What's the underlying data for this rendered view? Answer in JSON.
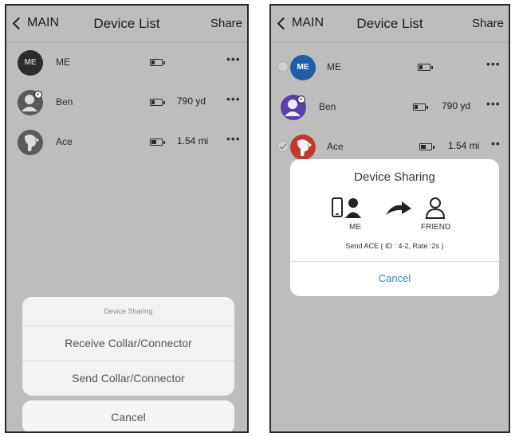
{
  "left_screen": {
    "nav": {
      "back_label": "MAIN",
      "title": "Device List",
      "share_label": "Share"
    },
    "devices": [
      {
        "avatar_text": "ME",
        "name": "ME",
        "distance": ""
      },
      {
        "name": "Ben",
        "distance": "790 yd"
      },
      {
        "name": "Ace",
        "distance": "1.54 mi"
      }
    ],
    "more_label": "•••",
    "action_sheet": {
      "title": "Device Sharing",
      "options": [
        "Receive Collar/Connector",
        "Send Collar/Connector"
      ],
      "cancel_label": "Cancel"
    }
  },
  "right_screen": {
    "nav": {
      "back_label": "MAIN",
      "title": "Device List",
      "share_label": "Share"
    },
    "devices": [
      {
        "avatar_text": "ME",
        "name": "ME",
        "distance": ""
      },
      {
        "name": "Ben",
        "distance": "790 yd"
      },
      {
        "name": "Ace",
        "distance": "1.54 mi"
      }
    ],
    "more_label": "•••",
    "more_label_short": "••",
    "dialog": {
      "title": "Device Sharing",
      "me_label": "ME",
      "friend_label": "FRIEND",
      "description": "Send ACE ( ID : 4-2, Rate :2s )",
      "cancel_label": "Cancel"
    }
  },
  "colors": {
    "overlay": "#bdbdbd",
    "accent": "#3a7bd5",
    "me_avatar": "#1d5ea7",
    "ben_avatar": "#5b3fa8",
    "ace_avatar": "#c0392b"
  }
}
